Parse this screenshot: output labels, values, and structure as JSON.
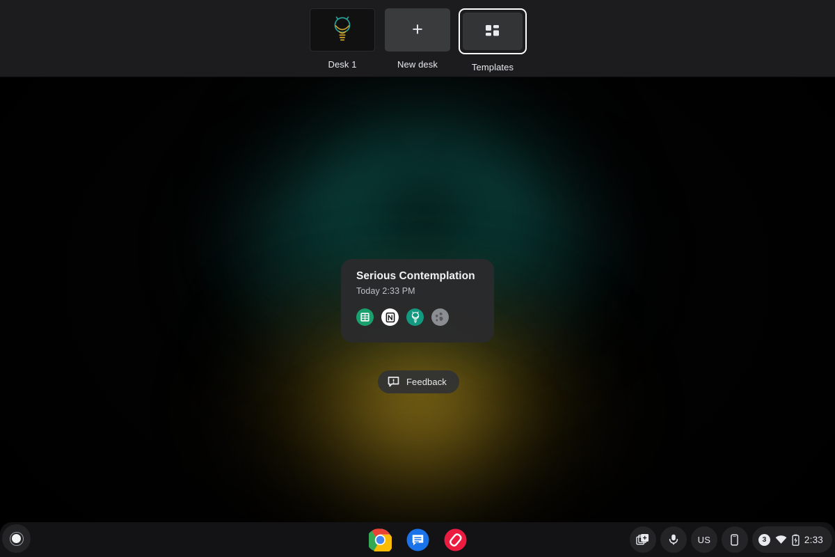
{
  "desk_bar": {
    "items": [
      {
        "id": "desk-1",
        "label": "Desk 1",
        "icon": "bulb-robot-wallpaper-thumbnail",
        "selected": false
      },
      {
        "id": "new-desk",
        "label": "New desk",
        "icon": "plus-icon",
        "selected": false
      },
      {
        "id": "templates",
        "label": "Templates",
        "icon": "template-grid-icon",
        "selected": true
      }
    ]
  },
  "template_card": {
    "title": "Serious Contemplation",
    "timestamp": "Today 2:33 PM",
    "apps": [
      {
        "name": "Google Sheets",
        "icon": "sheets-icon",
        "color": "#1aa06d"
      },
      {
        "name": "Notion",
        "icon": "notion-icon",
        "color": "#ffffff"
      },
      {
        "name": "Bulb Robot",
        "icon": "bulb-robot-icon",
        "color": "#13997f"
      },
      {
        "name": "Web Browser",
        "icon": "globe-icon",
        "color": "#8a8d91"
      }
    ]
  },
  "feedback": {
    "label": "Feedback",
    "icon": "feedback-comment-alert-icon"
  },
  "shelf": {
    "launcher": {
      "icon": "launcher-circle-icon"
    },
    "apps": [
      {
        "name": "Google Chrome",
        "icon": "chrome-icon"
      },
      {
        "name": "Google Messages",
        "icon": "messages-icon"
      },
      {
        "name": "Authy",
        "icon": "authy-icon"
      }
    ],
    "status": {
      "save_desk": {
        "icon": "save-desk-as-template-icon"
      },
      "dictation": {
        "icon": "microphone-icon"
      },
      "keyboard": {
        "label": "US",
        "icon": "keyboard-language-icon"
      },
      "phone_hub": {
        "icon": "phone-hub-icon"
      },
      "tray": {
        "notification_count": "3",
        "network": {
          "icon": "wifi-icon"
        },
        "battery": {
          "icon": "battery-charging-icon"
        },
        "time": "2:33"
      }
    }
  },
  "colors": {
    "shelf_background": "#131315",
    "desk_bar_background": "#1c1c1e",
    "card_background": "#2a2b2d",
    "accent_teal": "#13997f",
    "accent_amber": "#c6a228",
    "text_primary": "#e8eaed",
    "text_secondary": "#bdc1c6",
    "selection_outline": "#ffffff"
  }
}
